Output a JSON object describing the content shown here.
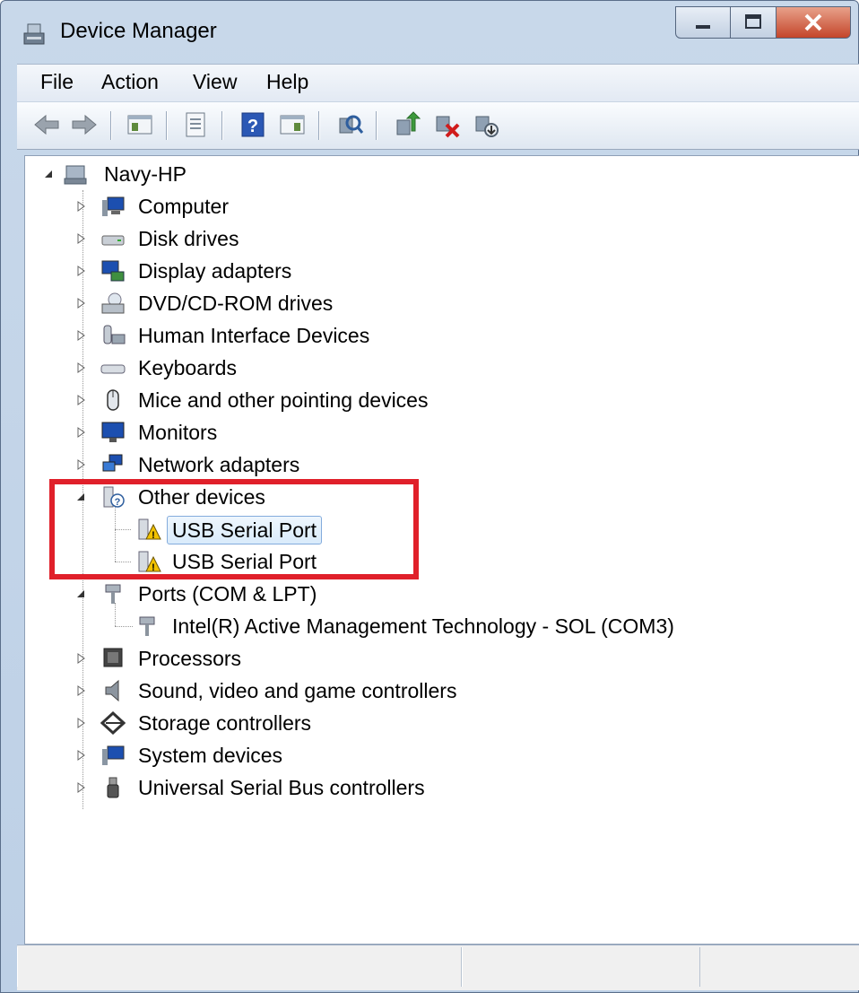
{
  "window": {
    "title": "Device Manager"
  },
  "menu": {
    "file": "File",
    "action": "Action",
    "view": "View",
    "help": "Help"
  },
  "toolbar": [
    "back-icon",
    "forward-icon",
    "show-hide-console-tree-icon",
    "properties-icon",
    "help-icon",
    "show-action-pane-icon",
    "scan-hardware-changes-icon",
    "update-driver-icon",
    "uninstall-icon",
    "disable-icon"
  ],
  "tree": {
    "root": "Navy-HP",
    "computer": "Computer",
    "disk_drives": "Disk drives",
    "display_adapters": "Display adapters",
    "dvd_drives": "DVD/CD-ROM drives",
    "hid": "Human Interface Devices",
    "keyboards": "Keyboards",
    "mice": "Mice and other pointing devices",
    "monitors": "Monitors",
    "network_adapters": "Network adapters",
    "other_devices": "Other devices",
    "usb_serial_1": "USB Serial Port",
    "usb_serial_2": "USB Serial Port",
    "ports": "Ports (COM & LPT)",
    "intel_amt": "Intel(R) Active Management Technology - SOL (COM3)",
    "processors": "Processors",
    "sound": "Sound, video and game controllers",
    "storage": "Storage controllers",
    "system_devices": "System devices",
    "usb_controllers": "Universal Serial Bus controllers"
  },
  "colors": {
    "highlight_box": "#e0202a",
    "warning": "#f2c200",
    "selection": "#d9ebfb"
  }
}
